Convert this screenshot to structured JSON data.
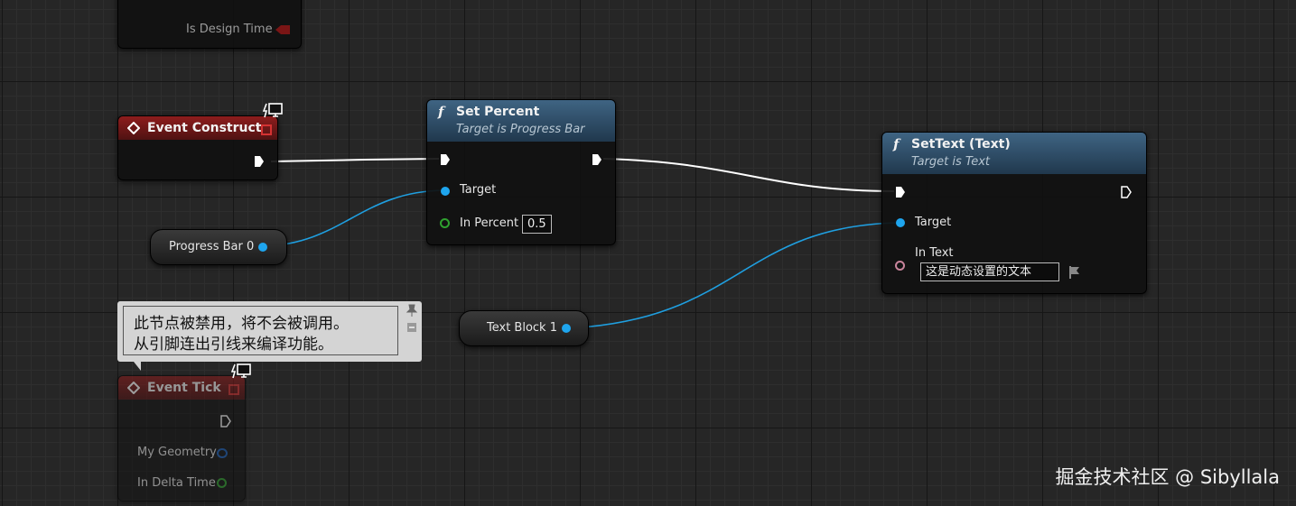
{
  "nodes": {
    "partial_top": {
      "pin_label": "Is Design Time"
    },
    "event_construct": {
      "title": "Event Construct"
    },
    "set_percent": {
      "title": "Set Percent",
      "subtitle": "Target is Progress Bar",
      "pin_target": "Target",
      "pin_in_percent": "In Percent",
      "in_percent_value": "0.5"
    },
    "set_text": {
      "title": "SetText (Text)",
      "subtitle": "Target is Text",
      "pin_target": "Target",
      "pin_in_text": "In Text",
      "in_text_value": "这是动态设置的文本"
    },
    "progress_bar_var": {
      "label": "Progress Bar 0"
    },
    "text_block_var": {
      "label": "Text Block 1"
    },
    "event_tick": {
      "title": "Event Tick",
      "pin_geometry": "My Geometry",
      "pin_delta": "In Delta Time"
    }
  },
  "comment": {
    "line1": "此节点被禁用，将不会被调用。",
    "line2": "从引脚连出引线来编译功能。"
  },
  "colors": {
    "exec_wire": "#ffffff",
    "object_wire": "#1f9fe0",
    "event_header": "#8e1d1d",
    "function_header": "#3f6483"
  },
  "watermark": "掘金技术社区 @ Sibyllala"
}
